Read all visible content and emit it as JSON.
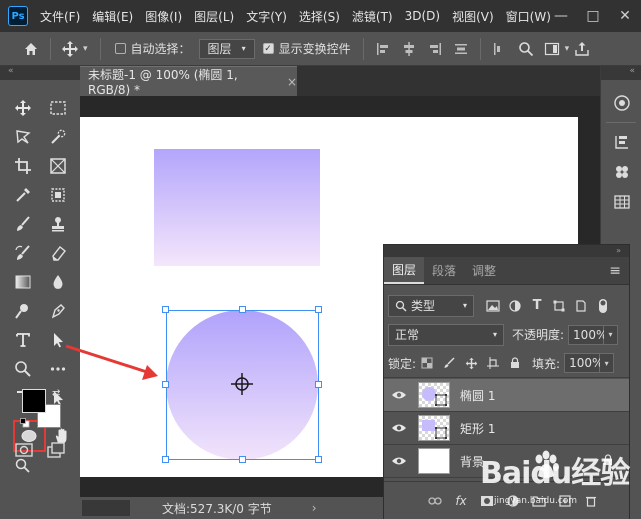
{
  "app": {
    "logo_text": "Ps"
  },
  "menu": [
    "文件(F)",
    "编辑(E)",
    "图像(I)",
    "图层(L)",
    "文字(Y)",
    "选择(S)",
    "滤镜(T)",
    "3D(D)",
    "视图(V)",
    "窗口(W)"
  ],
  "window_controls": {
    "minimize": "—",
    "maximize": "□",
    "close": "✕"
  },
  "options_bar": {
    "auto_select_label": "自动选择：",
    "auto_select_checked": false,
    "auto_select_target": "图层",
    "show_transform_label": "显示变换控件",
    "show_transform_checked": true
  },
  "document": {
    "tab_title": "未标题-1 @ 100% (椭圆 1, RGB/8) *",
    "close": "×"
  },
  "shapes": {
    "rectangle": {
      "top_color": "#b3a5fb",
      "bottom_color": "#f4e6fb"
    },
    "ellipse": {
      "top_color": "#b0a2fb",
      "bottom_color": "#f2e4fb",
      "selection_color": "#3f8ff7"
    }
  },
  "status": {
    "doc_info": "文档:527.3K/0 字节",
    "arrow": "›"
  },
  "collapse_glyph": "«",
  "layers_panel": {
    "tabs": [
      {
        "label": "图层",
        "active": true
      },
      {
        "label": "段落",
        "active": false
      },
      {
        "label": "调整",
        "active": false
      }
    ],
    "menu_icon": "≡",
    "filter_kind": "类型",
    "blend_mode": "正常",
    "opacity_label": "不透明度:",
    "opacity_value": "100%",
    "lock_label": "锁定:",
    "fill_label": "填充:",
    "fill_value": "100%",
    "layers": [
      {
        "name": "椭圆 1",
        "selected": true,
        "visible": true
      },
      {
        "name": "矩形 1",
        "selected": false,
        "visible": true
      },
      {
        "name": "背景",
        "selected": false,
        "visible": true,
        "locked": true
      }
    ],
    "footer_fx": "fx"
  },
  "annotation": {
    "highlight_color": "#e53935"
  },
  "watermark": {
    "brand": "Baidu经验",
    "url": "jingyan.baidu.com"
  }
}
